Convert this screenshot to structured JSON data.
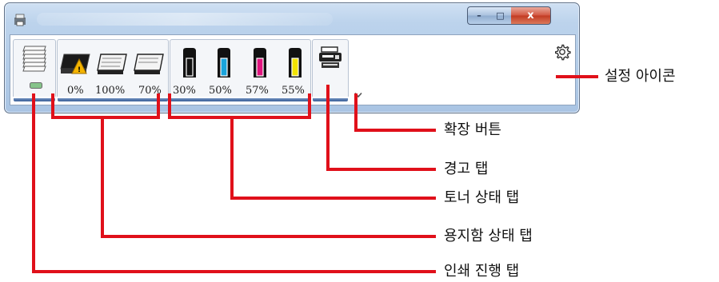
{
  "window": {
    "controls": {
      "minimize": "–",
      "maximize": "□",
      "close": "x"
    }
  },
  "tabs": {
    "print_progress": {
      "icon": "paper-stack-icon"
    },
    "paper_cassettes": {
      "items": [
        {
          "icon": "paper-tray-warning-icon",
          "level": "0%"
        },
        {
          "icon": "paper-tray-icon",
          "level": "100%"
        },
        {
          "icon": "paper-tray-icon",
          "level": "70%"
        }
      ]
    },
    "toner": {
      "items": [
        {
          "icon": "toner-black-icon",
          "color": "#111111",
          "level": "30%"
        },
        {
          "icon": "toner-cyan-icon",
          "color": "#19a4dc",
          "level": "50%"
        },
        {
          "icon": "toner-magenta-icon",
          "color": "#e0157e",
          "level": "57%"
        },
        {
          "icon": "toner-yellow-icon",
          "color": "#f3e400",
          "level": "55%"
        }
      ]
    },
    "alert": {
      "icon": "printer-alert-icon"
    }
  },
  "expand_icon": "chevron-down-icon",
  "settings_icon": "gear-icon",
  "callouts": {
    "settings": "설정 아이콘",
    "expand": "확장 버튼",
    "alert_tab": "경고 탭",
    "toner_tab": "토너 상태 탭",
    "paper_tab": "용지함 상태 탭",
    "print_tab": "인쇄 진행 탭"
  },
  "colors": {
    "connector": "#e0101a",
    "frame": "#a9c4e3"
  }
}
